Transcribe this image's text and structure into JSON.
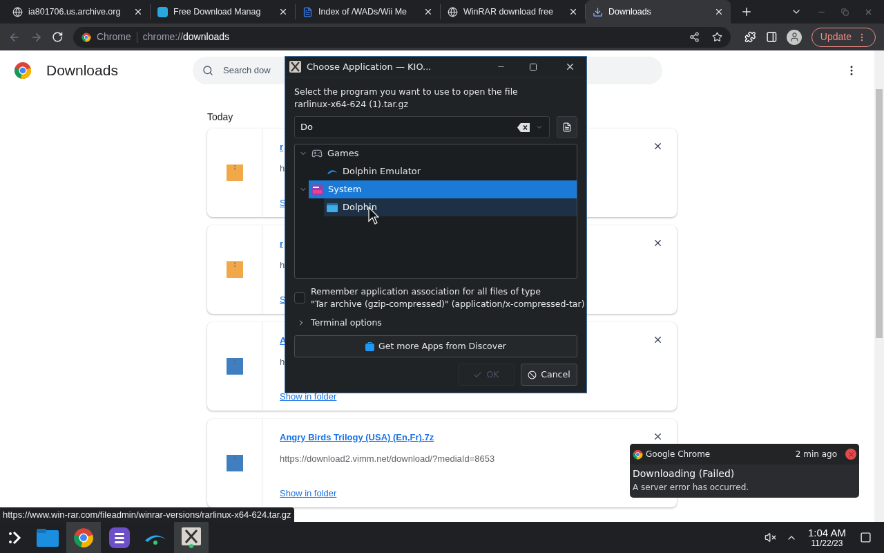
{
  "browser": {
    "tabs": [
      {
        "title": "ia801706.us.archive.org",
        "selected": false
      },
      {
        "title": "Free Download Manag",
        "selected": false
      },
      {
        "title": "Index of /WADs/Wii Me",
        "selected": false
      },
      {
        "title": "WinRAR download free",
        "selected": false
      },
      {
        "title": "Downloads",
        "selected": true
      }
    ],
    "site_label": "Chrome",
    "url_scheme": "chrome://",
    "url_host": "downloads",
    "update_button": "Update"
  },
  "page": {
    "title": "Downloads",
    "search": {
      "placeholder": "Search dow"
    },
    "section": "Today",
    "downloads": [
      {
        "name": "r",
        "url": "h",
        "link": "S",
        "color": "#f0a848"
      },
      {
        "name": "r",
        "url": "h",
        "link": "S",
        "color": "#f0a848"
      },
      {
        "name": "A",
        "url": "h",
        "link": "Show in folder",
        "color": "#3f7fc0"
      },
      {
        "name": "Angry Birds Trilogy (USA) (En,Fr).7z",
        "url": "https://download2.vimm.net/download/?mediaId=8653",
        "link": "Show in folder",
        "color": "#3f7fc0"
      }
    ]
  },
  "dialog": {
    "title": "Choose Application — KIO...",
    "prompt": "Select the program you want to use to open the file",
    "file": "rarlinux-x64-624 (1).tar.gz",
    "search_value": "Do",
    "tree": [
      {
        "label": "Games",
        "expanded": true,
        "selected": false,
        "hovered": false,
        "children": [
          {
            "label": "Dolphin Emulator",
            "selected": false,
            "hovered": false
          }
        ]
      },
      {
        "label": "System",
        "expanded": true,
        "selected": true,
        "hovered": false,
        "children": [
          {
            "label": "Dolphin",
            "selected": false,
            "hovered": true
          }
        ]
      }
    ],
    "remember": {
      "checked": false,
      "line1": "Remember application association for all files of type",
      "line2": "\"Tar archive (gzip-compressed)\" (application/x-compressed-tar)"
    },
    "terminal_options": {
      "label": "Terminal options",
      "expanded": false
    },
    "discover_button": "Get more Apps from Discover",
    "ok": {
      "label": "OK",
      "disabled": true
    },
    "cancel": {
      "label": "Cancel",
      "disabled": false
    }
  },
  "notification": {
    "app": "Google Chrome",
    "time": "2 min ago",
    "title": "Downloading (Failed)",
    "body": "A server error has occurred."
  },
  "status_url": "https://www.win-rar.com/fileadmin/winrar-versions/rarlinux-x64-624.tar.gz",
  "taskbar": {
    "apps": [
      {
        "kind": "files",
        "active": false
      },
      {
        "kind": "chrome",
        "active": true
      },
      {
        "kind": "bars",
        "active": false
      },
      {
        "kind": "dolphin",
        "active": false
      },
      {
        "kind": "kio",
        "active": true
      }
    ],
    "time": "1:04 AM",
    "date": "11/22/23"
  }
}
